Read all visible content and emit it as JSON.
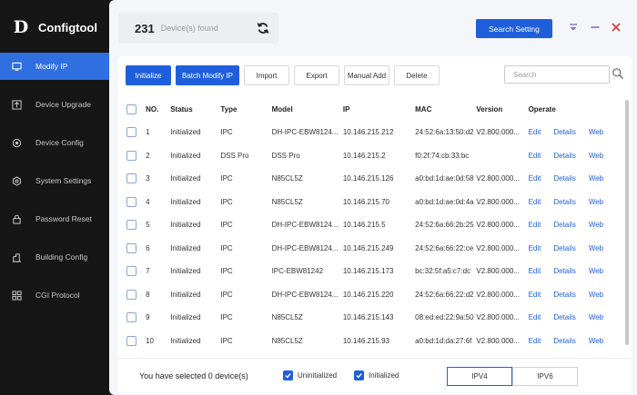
{
  "app": {
    "name": "Configtool",
    "logo_text": "D"
  },
  "sidebar": {
    "items": [
      {
        "label": "Modify IP",
        "icon": "monitor-icon",
        "active": true
      },
      {
        "label": "Device Upgrade",
        "icon": "upgrade-icon"
      },
      {
        "label": "Device Config",
        "icon": "config-icon"
      },
      {
        "label": "System Settings",
        "icon": "gear-icon"
      },
      {
        "label": "Password Reset",
        "icon": "lock-icon"
      },
      {
        "label": "Building Config",
        "icon": "building-icon"
      },
      {
        "label": "CGI Protocol",
        "icon": "grid-icon"
      }
    ]
  },
  "header": {
    "count": "231",
    "count_label": "Device(s) found",
    "search_setting_label": "Search Setting"
  },
  "toolbar": {
    "initialize": "Initialize",
    "batch_modify_ip": "Batch Modify IP",
    "import": "Import",
    "export": "Export",
    "manual_add": "Manual Add",
    "delete": "Delete",
    "search_placeholder": "Search"
  },
  "table": {
    "headers": [
      "NO.",
      "Status",
      "Type",
      "Model",
      "IP",
      "MAC",
      "Version",
      "Operate"
    ],
    "rows": [
      {
        "no": "1",
        "status": "Initialized",
        "type": "IPC",
        "model": "DH-IPC-EBW8124...",
        "ip": "10.146.215.212",
        "mac": "24:52:6a:13:50:d2",
        "version": "V2.800.000..."
      },
      {
        "no": "2",
        "status": "Initialized",
        "type": "DSS Pro",
        "model": "DSS Pro",
        "ip": "10.146.215.2",
        "mac": "f0:2f:74:cb:33:bc",
        "version": ""
      },
      {
        "no": "3",
        "status": "Initialized",
        "type": "IPC",
        "model": "N85CL5Z",
        "ip": "10.146.215.126",
        "mac": "a0:bd:1d:ae:0d:58",
        "version": "V2.800.000..."
      },
      {
        "no": "4",
        "status": "Initialized",
        "type": "IPC",
        "model": "N85CL5Z",
        "ip": "10.146.215.70",
        "mac": "a0:bd:1d:ae:0d:4a",
        "version": "V2.800.000..."
      },
      {
        "no": "5",
        "status": "Initialized",
        "type": "IPC",
        "model": "DH-IPC-EBW8124...",
        "ip": "10.146.215.5",
        "mac": "24:52:6a:66:2b:25",
        "version": "V2.800.000..."
      },
      {
        "no": "6",
        "status": "Initialized",
        "type": "IPC",
        "model": "DH-IPC-EBW8124...",
        "ip": "10.146.215.249",
        "mac": "24:52:6a:66:22:ce",
        "version": "V2.800.000..."
      },
      {
        "no": "7",
        "status": "Initialized",
        "type": "IPC",
        "model": "IPC-EBW81242",
        "ip": "10.146.215.173",
        "mac": "bc:32:5f:a5:c7:dc",
        "version": "V2.800.000..."
      },
      {
        "no": "8",
        "status": "Initialized",
        "type": "IPC",
        "model": "DH-IPC-EBW8124...",
        "ip": "10.146.215.220",
        "mac": "24:52:6a:66:22:d2",
        "version": "V2.800.000..."
      },
      {
        "no": "9",
        "status": "Initialized",
        "type": "IPC",
        "model": "N85CL5Z",
        "ip": "10.146.215.143",
        "mac": "08:ed:ed:22:9a:50",
        "version": "V2.800.000..."
      },
      {
        "no": "10",
        "status": "Initialized",
        "type": "IPC",
        "model": "N85CL5Z",
        "ip": "10.146.215.93",
        "mac": "a0:bd:1d:da:27:6f",
        "version": "V2.800.000..."
      }
    ],
    "ops": [
      "Edit",
      "Details",
      "Web"
    ]
  },
  "footer": {
    "selected_prefix": "You have selected",
    "selected_count": "0",
    "selected_suffix": "device(s)",
    "uninitialized": "Uninitialized",
    "initialized": "Initialized",
    "ipv4": "IPV4",
    "ipv6": "IPV6"
  },
  "colors": {
    "accent": "#1f5fdc",
    "sidebar": "#161616"
  }
}
